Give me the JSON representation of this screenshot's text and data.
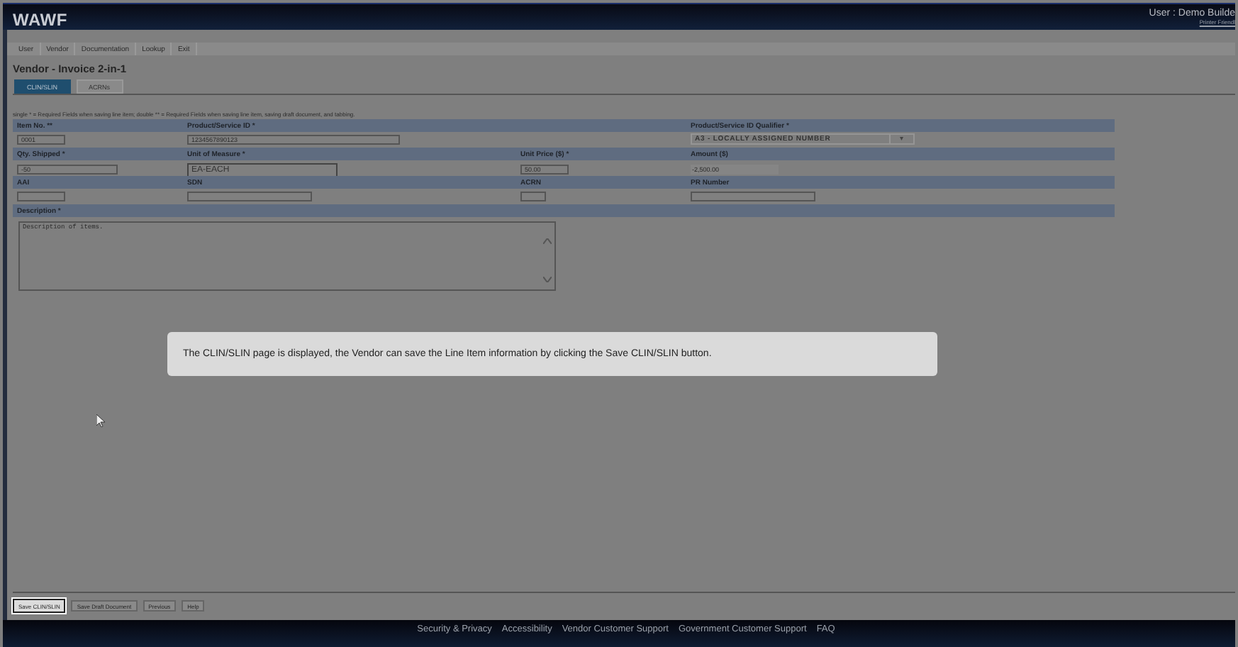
{
  "header": {
    "logo": "WAWF",
    "user": "User : Demo Builde",
    "link": "Printer Friendl"
  },
  "menu": [
    "User",
    "Vendor",
    "Documentation",
    "Lookup",
    "Exit"
  ],
  "page_title": "Vendor - Invoice 2-in-1",
  "tabs": [
    {
      "label": "CLIN/SLIN",
      "selected": true
    },
    {
      "label": "ACRNs",
      "selected": false
    }
  ],
  "legend": "single * = Required Fields when saving line item; double ** = Required Fields when saving line item, saving draft document, and tabbing.",
  "form_rows": [
    [
      {
        "label": "Item No. **",
        "field": {
          "kind": "input",
          "value": "0001"
        }
      },
      {
        "label": "Product/Service ID *",
        "field": {
          "kind": "input",
          "value": "1234567890123"
        }
      },
      null,
      {
        "label": "Product/Service ID Qualifier *",
        "field": {
          "kind": "select",
          "value": "A3 - LOCALLY ASSIGNED NUMBER",
          "arrow": "▾"
        }
      }
    ],
    [
      {
        "label": "Qty. Shipped *",
        "field": {
          "kind": "input",
          "value": "-50"
        }
      },
      {
        "label": "Unit of Measure *",
        "field": {
          "kind": "combo",
          "value": "EA-EACH"
        }
      },
      {
        "label": "Unit Price ($) *",
        "field": {
          "kind": "input",
          "value": "50.00"
        }
      },
      {
        "label": "Amount ($)",
        "field": {
          "kind": "readonly",
          "value": "-2,500.00"
        }
      }
    ],
    [
      {
        "label": "AAI",
        "field": {
          "kind": "input"
        }
      },
      {
        "label": "SDN",
        "field": {
          "kind": "input"
        }
      },
      {
        "label": "ACRN",
        "field": {
          "kind": "input"
        }
      },
      {
        "label": "PR Number",
        "field": {
          "kind": "input"
        }
      }
    ]
  ],
  "description": {
    "label": "Description *",
    "value": "Description of items."
  },
  "callout": "The CLIN/SLIN page is displayed, the Vendor can save the Line Item information by clicking the Save CLIN/SLIN button.",
  "buttons": [
    {
      "label": "Save CLIN/SLIN",
      "highlighted": true
    },
    {
      "label": "Save Draft Document",
      "highlighted": false
    },
    {
      "label": "Previous",
      "highlighted": false
    },
    {
      "label": "Help",
      "highlighted": false
    }
  ],
  "footer": [
    "Security & Privacy",
    "Accessibility",
    "Vendor Customer Support",
    "Government Customer Support",
    "FAQ"
  ]
}
